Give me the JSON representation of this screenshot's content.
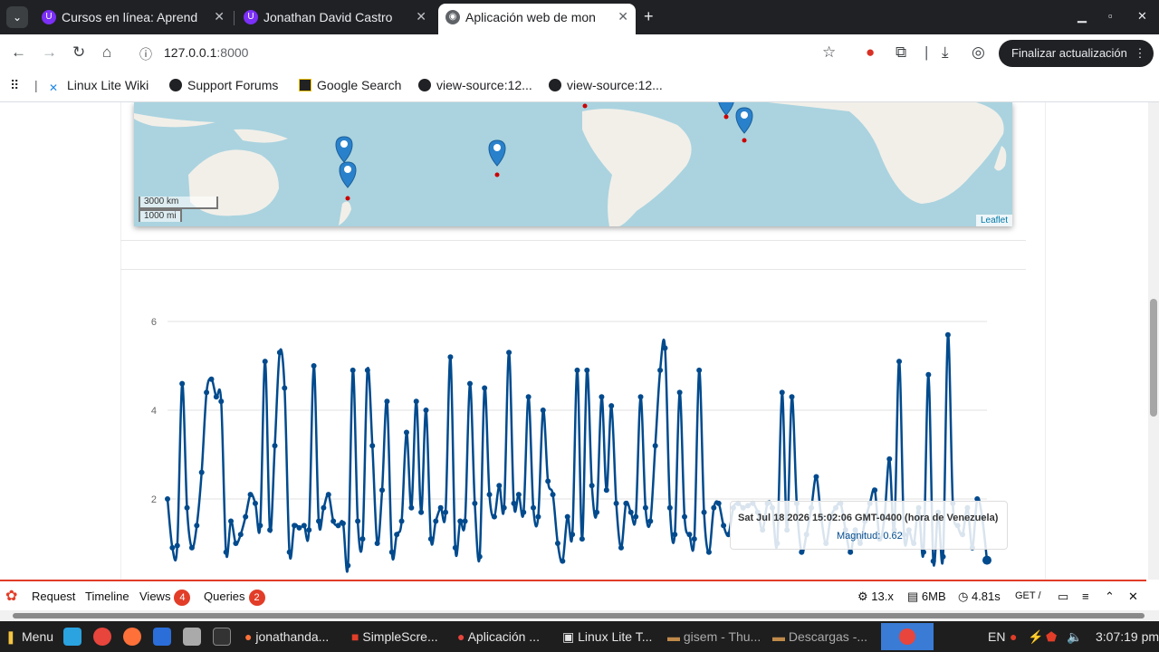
{
  "browser": {
    "tabs": [
      {
        "title": "Cursos en línea: Aprend",
        "active": false
      },
      {
        "title": "Jonathan David Castro",
        "active": false
      },
      {
        "title": "Aplicación web de mon",
        "active": true
      }
    ],
    "url_host": "127.0.0.1",
    "url_port": ":8000",
    "update_button": "Finalizar actualización",
    "menu_glyph": "⋮",
    "bookmarks": [
      "Linux Lite Wiki",
      "Support Forums",
      "Google Search",
      "view-source:12...",
      "view-source:12..."
    ]
  },
  "map": {
    "scale_km": "3000 km",
    "scale_mi": "1000 mi",
    "attribution": "Leaflet"
  },
  "chart_data": {
    "type": "line",
    "title": "",
    "xlabel": "",
    "ylabel": "",
    "ylim": [
      0,
      6
    ],
    "yticks": [
      "6",
      "4",
      "2"
    ],
    "series": [
      {
        "values": [
          2.0,
          0.9,
          0.95,
          4.6,
          1.8,
          0.9,
          1.4,
          2.6,
          4.4,
          4.7,
          4.3,
          4.2,
          0.8,
          1.5,
          1.0,
          1.2,
          1.6,
          2.1,
          1.9,
          1.4,
          5.1,
          1.3,
          3.2,
          5.3,
          4.5,
          0.8,
          1.4,
          1.35,
          1.4,
          1.3,
          5.0,
          1.5,
          1.8,
          2.1,
          1.5,
          1.4,
          1.45,
          0.5,
          4.9,
          1.5,
          1.1,
          4.9,
          3.2,
          1.0,
          2.2,
          4.2,
          0.8,
          1.2,
          1.5,
          3.5,
          1.8,
          4.2,
          1.7,
          4.0,
          1.1,
          1.5,
          1.8,
          1.7,
          5.2,
          0.9,
          1.5,
          1.5,
          4.6,
          1.9,
          0.7,
          4.5,
          2.1,
          1.6,
          2.3,
          1.8,
          5.3,
          1.9,
          2.1,
          1.7,
          4.3,
          1.8,
          1.6,
          4.0,
          2.4,
          2.1,
          1.0,
          0.6,
          1.6,
          1.2,
          4.9,
          1.1,
          4.9,
          2.3,
          1.7,
          4.3,
          2.2,
          4.1,
          1.9,
          0.9,
          1.9,
          1.7,
          1.6,
          4.3,
          1.8,
          1.5,
          3.2,
          4.9,
          5.4,
          1.8,
          1.2,
          4.4,
          1.6,
          1.2,
          1.1,
          4.9,
          1.7,
          0.8,
          1.8,
          1.9,
          1.4,
          1.2,
          1.8,
          1.9,
          1.8,
          1.85,
          1.9,
          1.7,
          1.3,
          1.9,
          1.8,
          1.0,
          4.4,
          1.3,
          4.3,
          1.9,
          0.8,
          1.2,
          1.8,
          2.5,
          1.6,
          1.0,
          1.6,
          1.8,
          1.9,
          1.3,
          0.8,
          1.3,
          1.0,
          1.5,
          1.9,
          2.2,
          1.1,
          1.6,
          2.9,
          1.3,
          5.1,
          1.2,
          1.3,
          1.0,
          1.8,
          0.8,
          4.8,
          0.6,
          1.7,
          0.7,
          5.7,
          1.9,
          1.4,
          1.2,
          1.8,
          0.9,
          2.0,
          1.6,
          0.62
        ],
        "color": "#004a8d"
      }
    ]
  },
  "tooltip": {
    "date": "Sat Jul 18 2026 15:02:06 GMT-0400 (hora de Venezuela)",
    "value": "Magnitud: 0.62"
  },
  "debugbar": {
    "request": "Request",
    "timeline": "Timeline",
    "views": "Views",
    "views_count": "4",
    "queries": "Queries",
    "queries_count": "2",
    "version": "13.x",
    "memory": "6MB",
    "time": "4.81s",
    "method": "GET",
    "route": "/"
  },
  "taskbar": {
    "menu": "Menu",
    "items": [
      "jonathanda...",
      "SimpleScre...",
      "Aplicación ...",
      "Linux Lite T...",
      "gisem - Thu...",
      "Descargas -..."
    ],
    "lang": "EN",
    "clock": "3:07:19 pm"
  }
}
